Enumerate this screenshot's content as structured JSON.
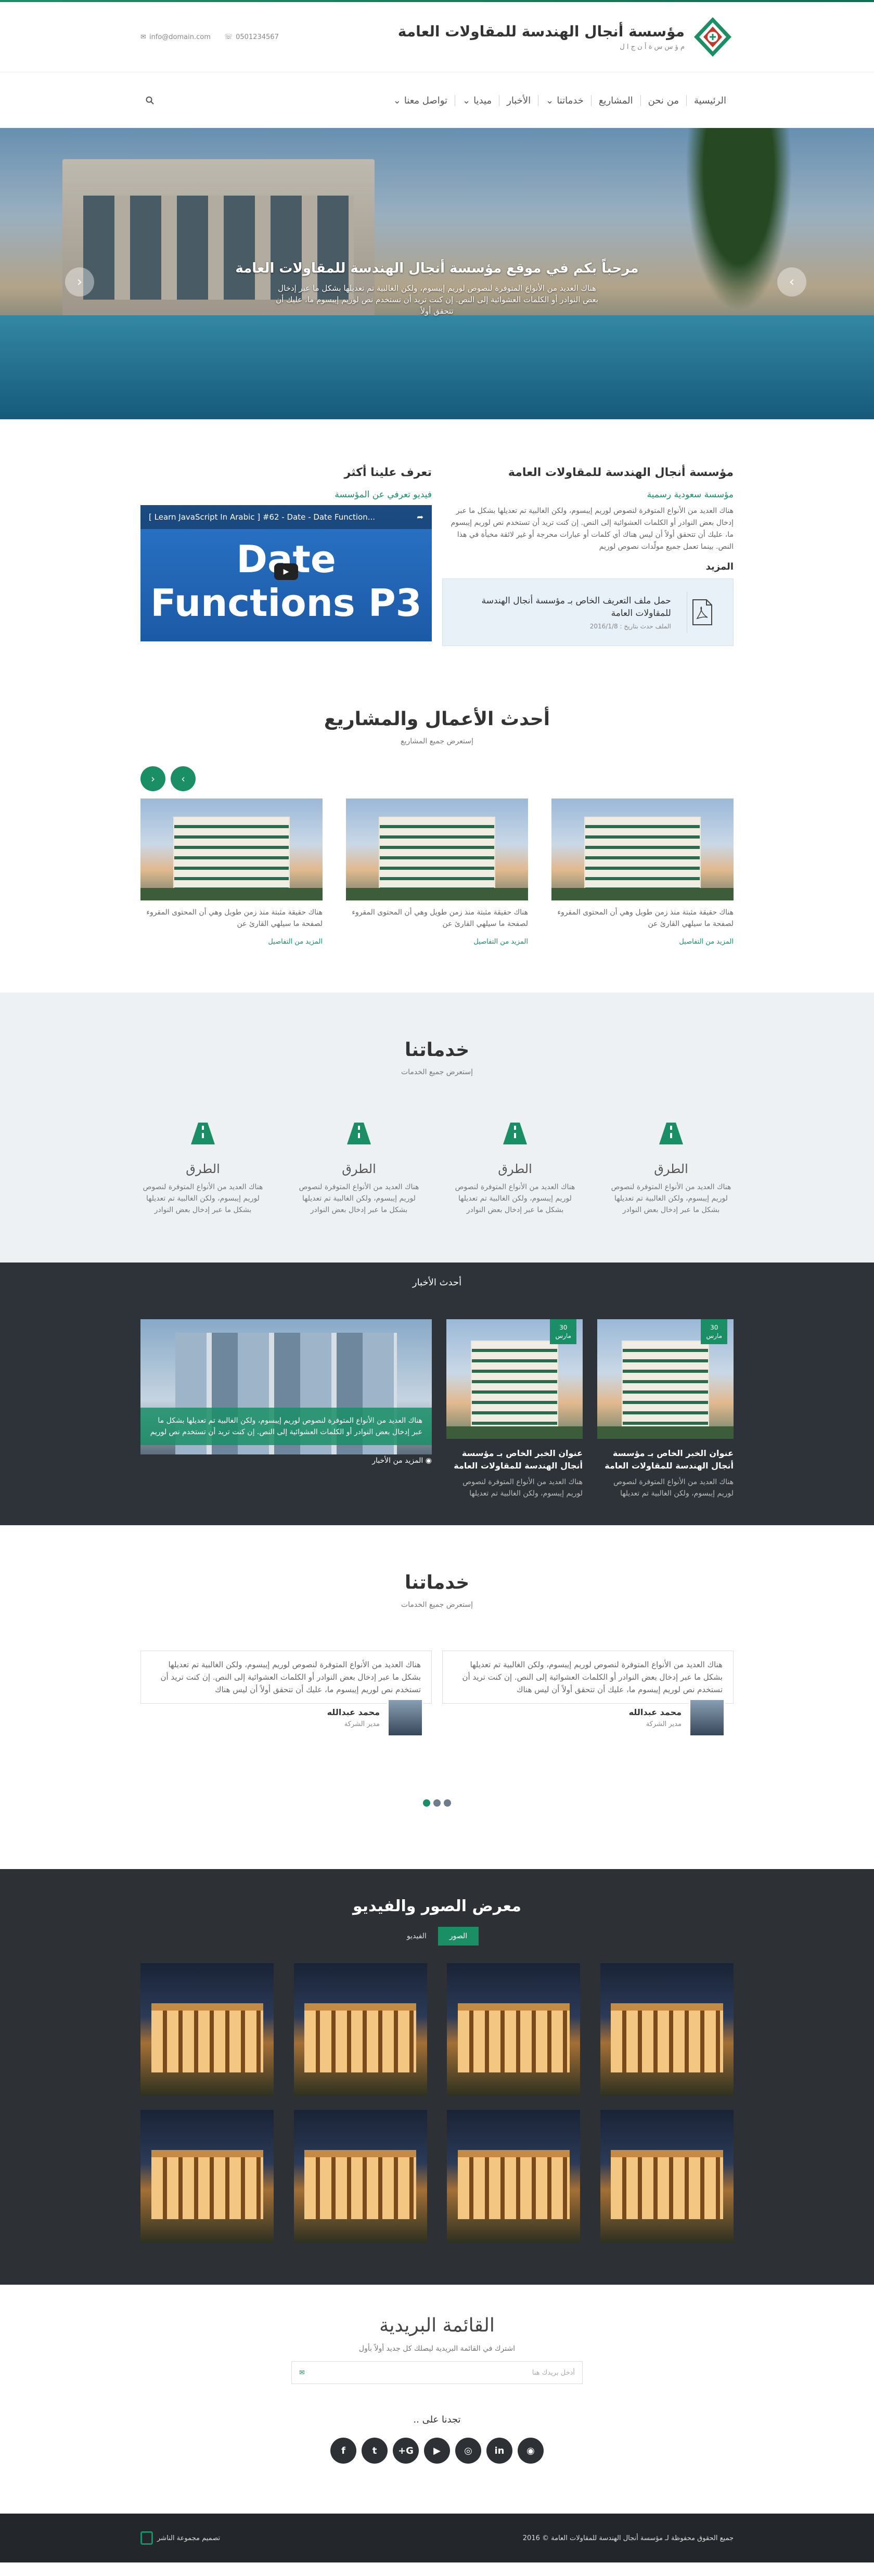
{
  "header": {
    "site_name": "مؤسسة أنجال الهندسة للمقاولات العامة",
    "site_sub": "م ؤ س س ة أ ن ج ا ل",
    "email": "info@domain.com",
    "phone": "0501234567"
  },
  "nav": {
    "items": [
      {
        "label": "الرئيسية",
        "caret": false
      },
      {
        "label": "من نحن",
        "caret": false
      },
      {
        "label": "المشاريع",
        "caret": false
      },
      {
        "label": "خدماتنا",
        "caret": true
      },
      {
        "label": "الأخبار",
        "caret": false
      },
      {
        "label": "ميديا",
        "caret": true
      },
      {
        "label": "تواصل معنا",
        "caret": true
      }
    ]
  },
  "hero": {
    "title": "مرحباً بكم في موقع مؤسسة أنجال الهندسة للمقاولات العامة",
    "text": "هناك العديد من الأنواع المتوفرة لنصوص لوريم إيبسوم، ولكن الغالبية تم تعديلها بشكل ما عبر إدخال بعض النوادر أو الكلمات العشوائية إلى النص. إن كنت تريد أن تستخدم نص لوريم إيبسوم ما، عليك أن تتحقق أولاً"
  },
  "about": {
    "title": "مؤسسة أنجال الهندسة للمقاولات العامة",
    "subtitle": "مؤسسة سعودية رسمية",
    "text": "هناك العديد من الأنواع المتوفرة لنصوص لوريم إيبسوم، ولكن الغالبية تم تعديلها بشكل ما عبر إدخال بعض النوادر أو الكلمات العشوائية إلى النص. إن كنت تريد أن تستخدم نص لوريم إيبسوم ما، عليك أن تتحقق أولاً أن ليس هناك أي كلمات أو عبارات محرجة أو غير لائقة مخبأة في هذا النص. بينما تعمل جميع مولّدات نصوص لوريم",
    "more": "المزيد",
    "file_title": "حمل ملف التعريف الخاص بـ مؤسسة أنجال الهندسة للمقاولات العامة",
    "file_date": "الملف حدث بتاريخ : 2016/1/8",
    "know_title": "تعرف علينا أكثر",
    "know_sub": "فيديو تعرفي عن المؤسسة",
    "video_bar": "[ Learn JavaScript In Arabic ] #62 - Date - Date Function...",
    "video_big1": "Date",
    "video_big2": "Functions P3"
  },
  "projects": {
    "title": "أحدث الأعمال والمشاريع",
    "all": "إستعرض جميع المشاريع",
    "items": [
      {
        "text": "هناك حقيقة مثبتة منذ زمن طويل وهي أن المحتوى المقروء لصفحة ما سيلهي القارئ عن",
        "link": "المزيد من التفاصيل"
      },
      {
        "text": "هناك حقيقة مثبتة منذ زمن طويل وهي أن المحتوى المقروء لصفحة ما سيلهي القارئ عن",
        "link": "المزيد من التفاصيل"
      },
      {
        "text": "هناك حقيقة مثبتة منذ زمن طويل وهي أن المحتوى المقروء لصفحة ما سيلهي القارئ عن",
        "link": "المزيد من التفاصيل"
      }
    ]
  },
  "services": {
    "title": "خدماتنا",
    "all": "إستعرض جميع الخدمات",
    "items": [
      {
        "title": "الطرق",
        "text": "هناك العديد من الأنواع المتوفرة لنصوص لوريم إيبسوم، ولكن الغالبية تم تعديلها بشكل ما عبر إدخال بعض النوادر"
      },
      {
        "title": "الطرق",
        "text": "هناك العديد من الأنواع المتوفرة لنصوص لوريم إيبسوم، ولكن الغالبية تم تعديلها بشكل ما عبر إدخال بعض النوادر"
      },
      {
        "title": "الطرق",
        "text": "هناك العديد من الأنواع المتوفرة لنصوص لوريم إيبسوم، ولكن الغالبية تم تعديلها بشكل ما عبر إدخال بعض النوادر"
      },
      {
        "title": "الطرق",
        "text": "هناك العديد من الأنواع المتوفرة لنصوص لوريم إيبسوم، ولكن الغالبية تم تعديلها بشكل ما عبر إدخال بعض النوادر"
      }
    ]
  },
  "news": {
    "title": "أحدث الأخبار",
    "cards": [
      {
        "day": "30",
        "month": "مارس",
        "title": "عنوان الخبر الخاص بـ مؤسسة أنجال الهندسة للمقاولات العامة",
        "text": "هناك العديد من الأنواع المتوفرة لنصوص لوريم إيبسوم، ولكن الغالبية تم تعديلها"
      },
      {
        "day": "30",
        "month": "مارس",
        "title": "عنوان الخبر الخاص بـ مؤسسة أنجال الهندسة للمقاولات العامة",
        "text": "هناك العديد من الأنواع المتوفرة لنصوص لوريم إيبسوم، ولكن الغالبية تم تعديلها"
      }
    ],
    "feature_text": "هناك العديد من الأنواع المتوفرة لنصوص لوريم إيبسوم، ولكن الغالبية تم تعديلها بشكل ما عبر إدخال بعض النوادر أو الكلمات العشوائية إلى النص. إن كنت تريد أن تستخدم نص لوريم",
    "more": "المزيد من الأخبار"
  },
  "testimonials": {
    "title": "خدماتنا",
    "all": "إستعرض جميع الخدمات",
    "items": [
      {
        "quote": "هناك العديد من الأنواع المتوفرة لنصوص لوريم إيبسوم، ولكن الغالبية تم تعديلها بشكل ما عبر إدخال بعض النوادر أو الكلمات العشوائية إلى النص. إن كنت تريد أن تستخدم نص لوريم إيبسوم ما، عليك أن تتحقق أولاً أن ليس هناك",
        "name": "محمد عبدالله",
        "role": "مدير الشركة"
      },
      {
        "quote": "هناك العديد من الأنواع المتوفرة لنصوص لوريم إيبسوم، ولكن الغالبية تم تعديلها بشكل ما عبر إدخال بعض النوادر أو الكلمات العشوائية إلى النص. إن كنت تريد أن تستخدم نص لوريم إيبسوم ما، عليك أن تتحقق أولاً أن ليس هناك",
        "name": "محمد عبدالله",
        "role": "مدير الشركة"
      }
    ]
  },
  "gallery": {
    "title": "معرض الصور والفيديو",
    "tab_photos": "الصور",
    "tab_video": "الفيديو"
  },
  "newsletter": {
    "title": "القائمة البريدية",
    "desc": "اشترك في القائمة البريدية ليصلك كل جديد أولاً بأول",
    "placeholder": "أدخل بريدك هنا",
    "follow": "تجدنا على ..",
    "socials": [
      "rss-icon",
      "linkedin-icon",
      "instagram-icon",
      "youtube-icon",
      "google-plus-icon",
      "twitter-icon",
      "facebook-icon"
    ]
  },
  "footer": {
    "copyright": "جميع الحقوق محفوظة لـ مؤسسة أنجال الهندسة للمقاولات العامة © 2016",
    "dev": "تصميم مجموعة الناشر"
  },
  "colors": {
    "accent": "#1a8f66",
    "dark": "#2d3136"
  }
}
